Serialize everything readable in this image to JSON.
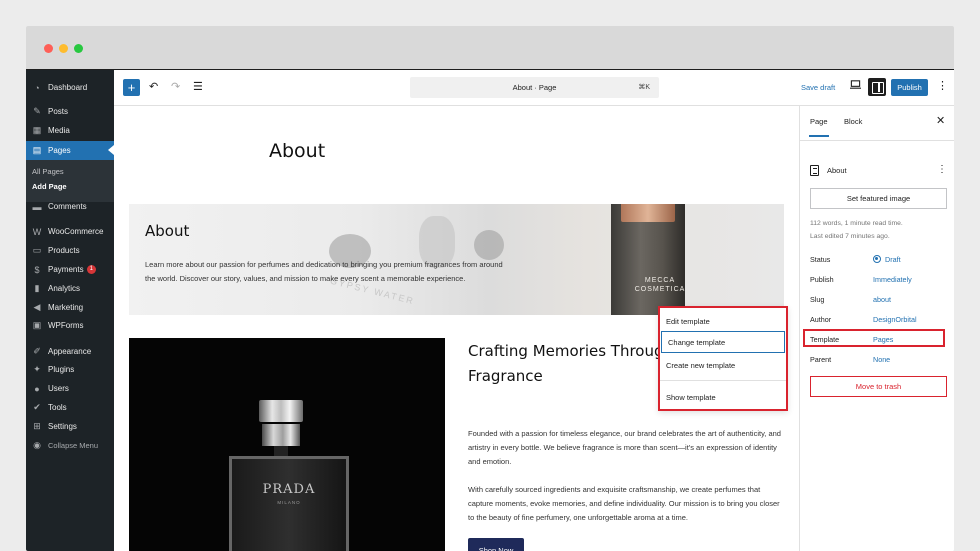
{
  "sidebar": {
    "items": [
      {
        "label": "Dashboard",
        "icon": "dashboard-icon"
      },
      {
        "label": "Posts",
        "icon": "pin-icon"
      },
      {
        "label": "Media",
        "icon": "media-icon"
      },
      {
        "label": "Pages",
        "icon": "pages-icon"
      },
      {
        "label": "Comments",
        "icon": "comment-icon"
      },
      {
        "label": "WooCommerce",
        "icon": "woocommerce-icon"
      },
      {
        "label": "Products",
        "icon": "products-icon"
      },
      {
        "label": "Payments",
        "icon": "payments-icon",
        "badge": "1"
      },
      {
        "label": "Analytics",
        "icon": "analytics-icon"
      },
      {
        "label": "Marketing",
        "icon": "megaphone-icon"
      },
      {
        "label": "WPForms",
        "icon": "forms-icon"
      },
      {
        "label": "Appearance",
        "icon": "brush-icon"
      },
      {
        "label": "Plugins",
        "icon": "plugin-icon"
      },
      {
        "label": "Users",
        "icon": "user-icon"
      },
      {
        "label": "Tools",
        "icon": "wrench-icon"
      },
      {
        "label": "Settings",
        "icon": "settings-icon"
      },
      {
        "label": "Collapse Menu",
        "icon": "collapse-icon"
      }
    ],
    "submenu": [
      "All Pages",
      "Add Page"
    ]
  },
  "toolbar": {
    "command_text": "About · Page",
    "command_shortcut": "⌘K",
    "save_draft": "Save draft",
    "publish": "Publish"
  },
  "editor": {
    "page_title": "About",
    "hero": {
      "heading": "About",
      "text": "Learn more about our passion for perfumes and dedication to bringing you premium fragrances from around the world. Discover our story, values, and mission to make every scent a memorable experience.",
      "bottle_text": "MECCA COSMETICA",
      "watermark": "GYPSY WATER"
    },
    "product_brand": "PRADA",
    "product_sub": "MILANO",
    "section_title": "Crafting Memories Through Fragrance",
    "para1": "Founded with a passion for timeless elegance, our brand celebrates the art of authenticity, and artistry in every bottle. We believe fragrance is more than scent—it's an expression of identity and emotion.",
    "para2": "With carefully sourced ingredients and exquisite craftsmanship, we create perfumes that capture moments, evoke memories, and define individuality. Our mission is to bring you closer to the beauty of fine perfumery, one unforgettable aroma at a time.",
    "shop_button": "Shop Now"
  },
  "dropdown": {
    "items": [
      "Edit template",
      "Change template",
      "Create new template",
      "Show template"
    ]
  },
  "panel": {
    "tabs": [
      "Page",
      "Block"
    ],
    "doc_title": "About",
    "featured_button": "Set featured image",
    "meta_words": "112 words, 1 minute read time.",
    "meta_edited": "Last edited 7 minutes ago.",
    "rows": [
      {
        "label": "Status",
        "value": "Draft"
      },
      {
        "label": "Publish",
        "value": "Immediately"
      },
      {
        "label": "Slug",
        "value": "about"
      },
      {
        "label": "Author",
        "value": "DesignOrbital"
      },
      {
        "label": "Template",
        "value": "Pages"
      },
      {
        "label": "Parent",
        "value": "None"
      }
    ],
    "trash_button": "Move to trash"
  },
  "colors": {
    "accent": "#2271b1",
    "sidebar_bg": "#1d2327",
    "highlight": "#d9232e",
    "shop_button": "#1f2a5a"
  }
}
